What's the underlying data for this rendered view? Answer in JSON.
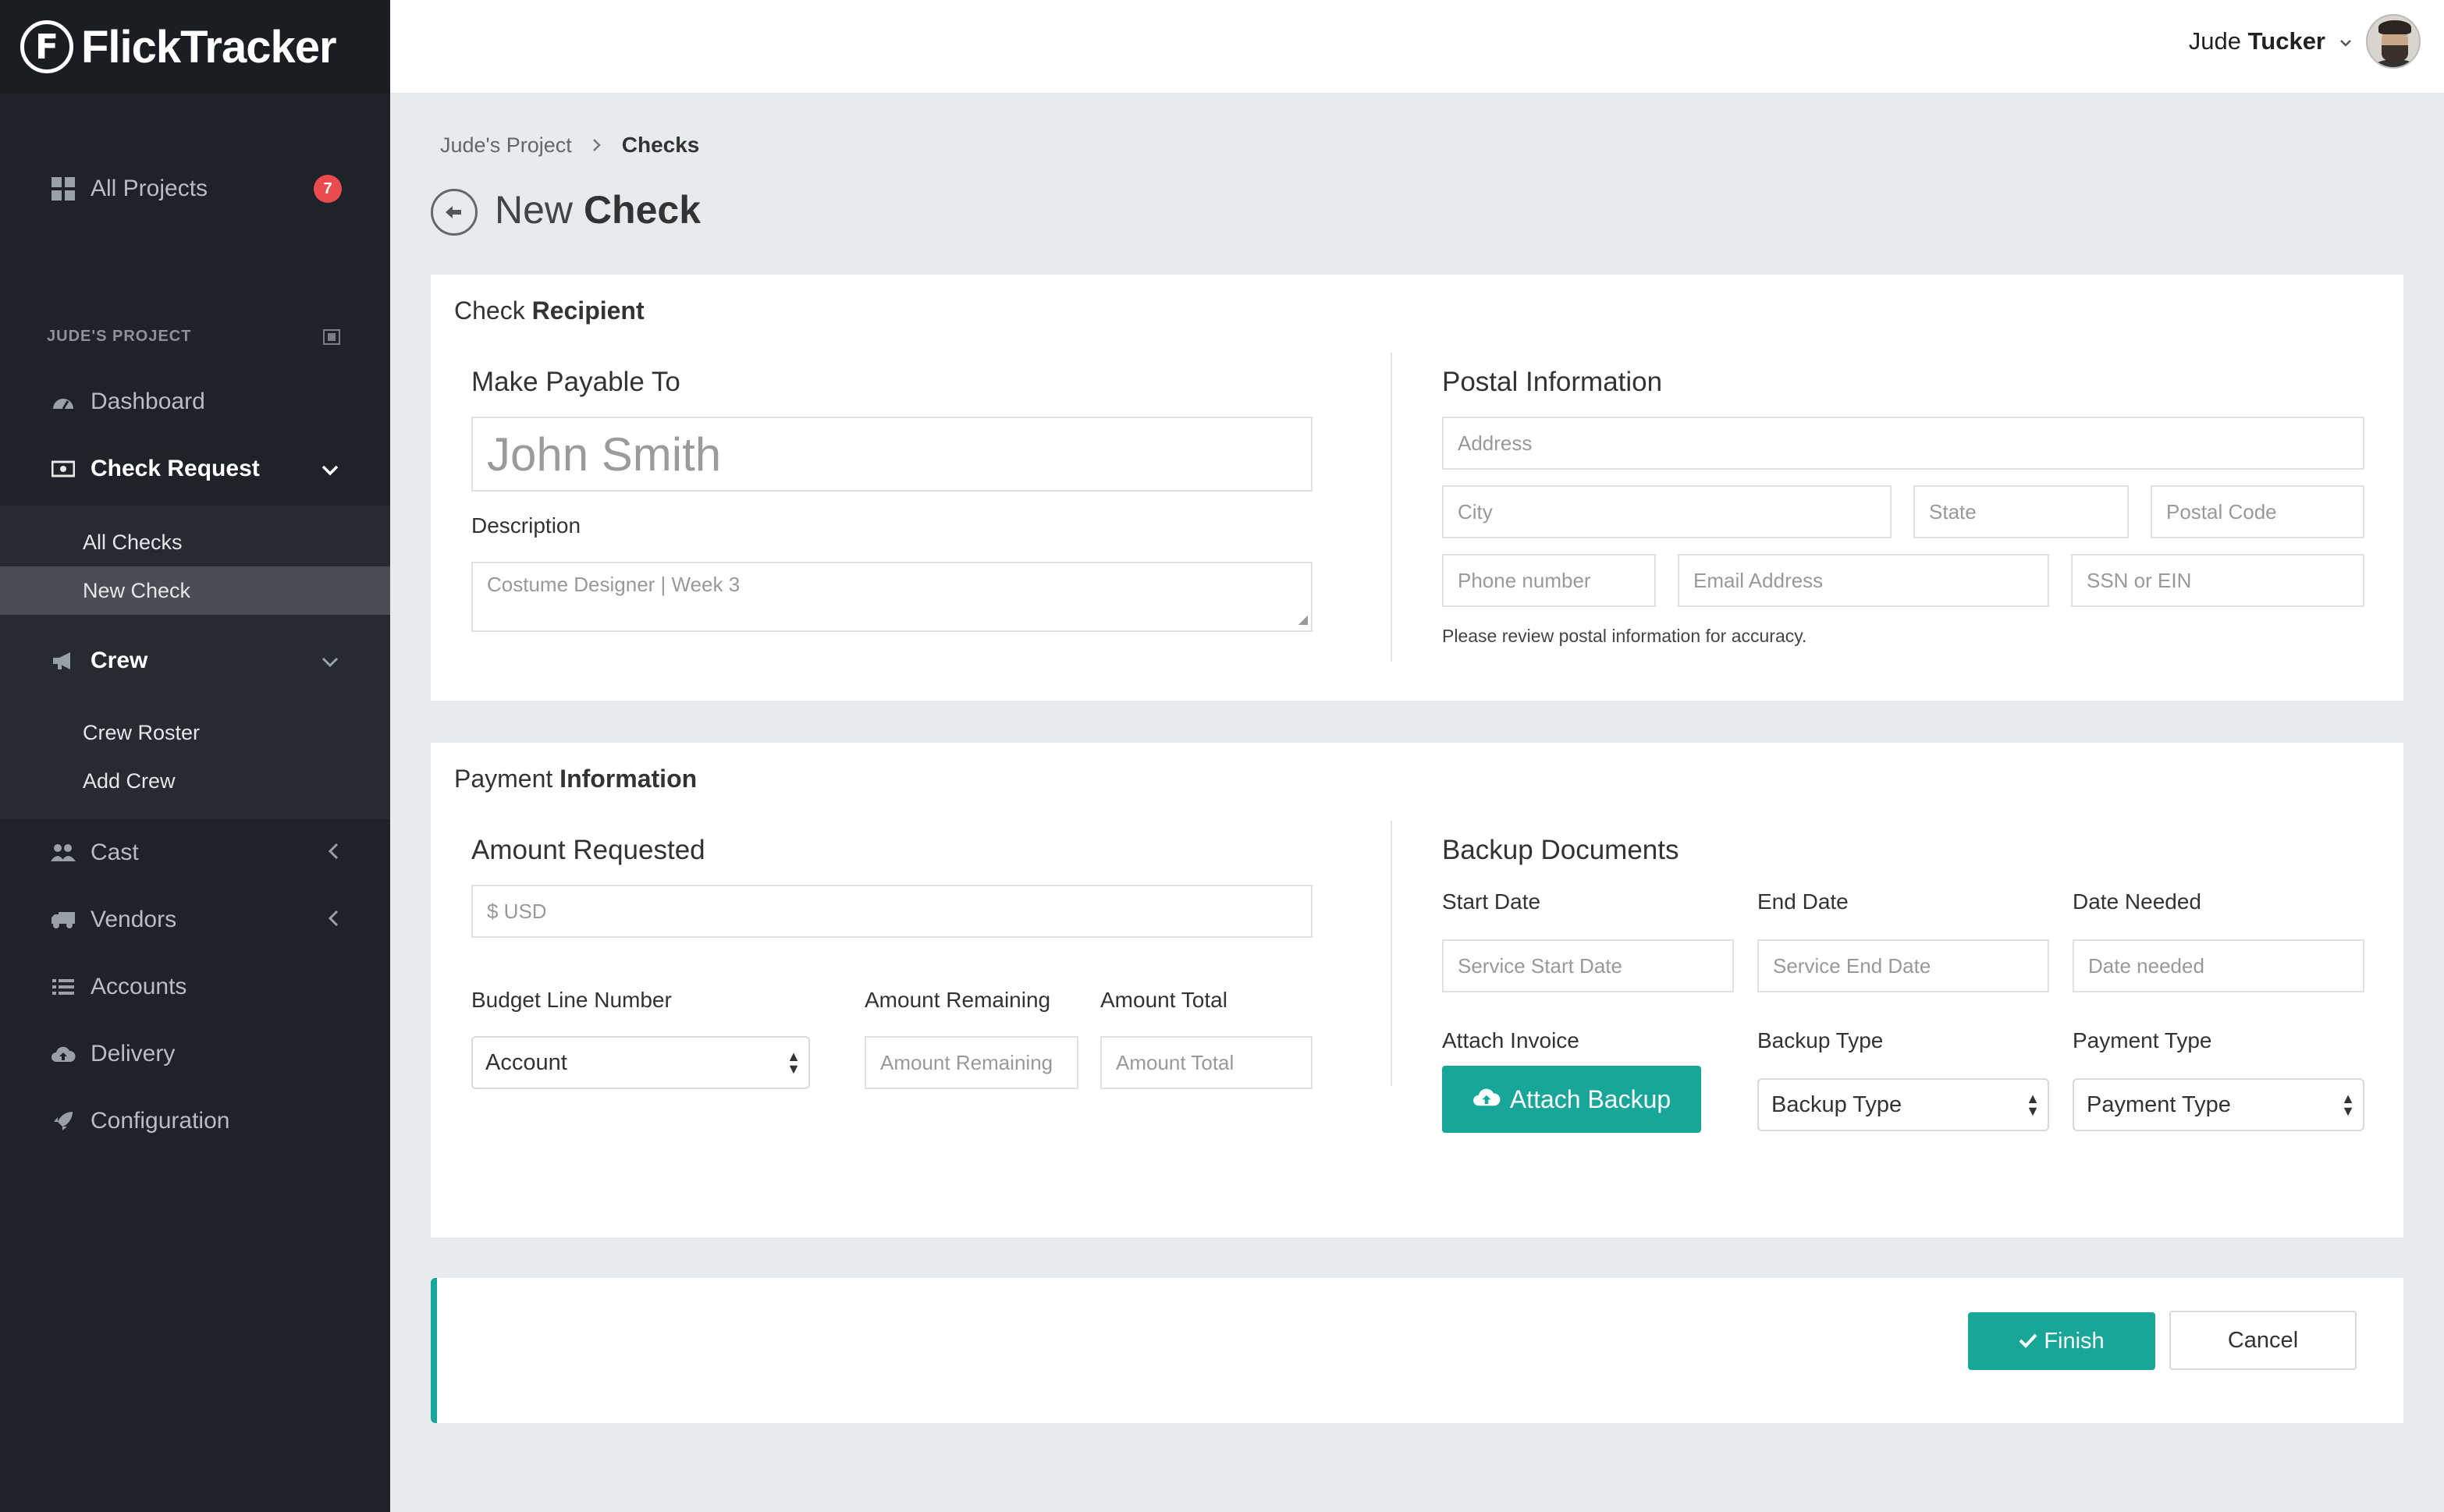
{
  "app": {
    "name": "FlickTracker",
    "logo_letter": "F"
  },
  "sidebar": {
    "all_projects": {
      "label": "All Projects",
      "badge": "7"
    },
    "section_label": "JUDE'S PROJECT",
    "items": [
      {
        "label": "Dashboard",
        "icon": "gauge-icon"
      },
      {
        "label": "Check Request",
        "icon": "money-icon"
      },
      {
        "label": "Crew",
        "icon": "megaphone-icon"
      },
      {
        "label": "Cast",
        "icon": "users-icon"
      },
      {
        "label": "Vendors",
        "icon": "truck-icon"
      },
      {
        "label": "Accounts",
        "icon": "list-icon"
      },
      {
        "label": "Delivery",
        "icon": "cloud-upload-icon"
      },
      {
        "label": "Configuration",
        "icon": "rocket-icon"
      }
    ],
    "check_request_sub": [
      "All Checks",
      "New Check"
    ],
    "crew_sub": [
      "Crew Roster",
      "Add Crew"
    ]
  },
  "topbar": {
    "user_first": "Jude",
    "user_last": "Tucker"
  },
  "breadcrumb": {
    "parent": "Jude's Project",
    "current": "Checks"
  },
  "page": {
    "title_light": "New",
    "title_bold": "Check"
  },
  "recipient": {
    "title_light": "Check",
    "title_bold": "Recipient",
    "payable_heading": "Make Payable To",
    "payable_placeholder": "John Smith",
    "description_label": "Description",
    "description_placeholder": "Costume Designer | Week 3",
    "postal_heading": "Postal Information",
    "address_placeholder": "Address",
    "city_placeholder": "City",
    "state_placeholder": "State",
    "postal_code_placeholder": "Postal Code",
    "phone_placeholder": "Phone number",
    "email_placeholder": "Email Address",
    "ssn_placeholder": "SSN or EIN",
    "help_text": "Please review postal information for accuracy."
  },
  "payment": {
    "title_light": "Payment",
    "title_bold": "Information",
    "amount_heading": "Amount Requested",
    "amount_placeholder": "$ USD",
    "budget_label": "Budget Line Number",
    "budget_value": "Account",
    "remaining_label": "Amount Remaining",
    "remaining_placeholder": "Amount Remaining",
    "total_label": "Amount Total",
    "total_placeholder": "Amount Total",
    "backup_heading": "Backup Documents",
    "start_label": "Start Date",
    "start_placeholder": "Service Start Date",
    "end_label": "End Date",
    "end_placeholder": "Service End Date",
    "needed_label": "Date Needed",
    "needed_placeholder": "Date needed",
    "attach_label": "Attach Invoice",
    "attach_button": "Attach Backup",
    "backup_type_label": "Backup Type",
    "backup_type_value": "Backup Type",
    "payment_type_label": "Payment Type",
    "payment_type_value": "Payment Type"
  },
  "footer": {
    "finish": "Finish",
    "cancel": "Cancel"
  },
  "colors": {
    "accent": "#17a697",
    "sidebar": "#1f2228",
    "badge": "#e84c4c"
  }
}
